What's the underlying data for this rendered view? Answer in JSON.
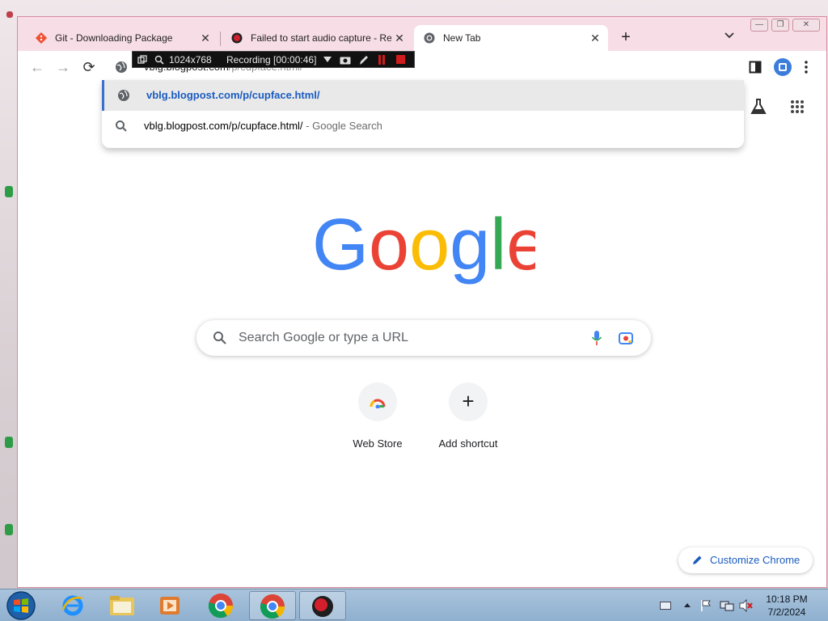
{
  "tabs": [
    {
      "title": "Git - Downloading Package",
      "icon": "git-icon"
    },
    {
      "title": "Failed to start audio capture - Re",
      "icon": "record-icon"
    },
    {
      "title": "New Tab",
      "icon": "chrome-icon",
      "active": true
    }
  ],
  "tab_close_glyph": "✕",
  "new_tab_glyph": "+",
  "tab_search_glyph": "⌄",
  "window_controls": {
    "minimize": "—",
    "restore": "❐",
    "close": "✕"
  },
  "nav": {
    "back": "←",
    "forward": "→",
    "reload": "⟳"
  },
  "omnibox": {
    "typed": "vblg.blogpost.com",
    "completion": "/p/cupface.html/"
  },
  "suggestions": [
    {
      "text": "vblg.blogpost.com/p/cupface.html/",
      "suffix": "",
      "icon": "globe-icon",
      "selected": true
    },
    {
      "text": "vblg.blogpost.com/p/cupface.html/",
      "suffix": " - Google Search",
      "icon": "search-icon"
    }
  ],
  "recorder": {
    "resolution": "1024x768",
    "status": "Recording [00:00:46]"
  },
  "search": {
    "placeholder": "Search Google or type a URL"
  },
  "shortcuts": [
    {
      "label": "Web Store",
      "icon": "webstore-icon"
    },
    {
      "label": "Add shortcut",
      "icon": "plus-icon",
      "glyph": "+"
    }
  ],
  "customize_label": "Customize Chrome",
  "clock": {
    "time": "10:18 PM",
    "date": "7/2/2024"
  },
  "colors": {
    "tabstrip": "#f7dde5",
    "accent": "#1a5bbf",
    "google_blue": "#4285f4",
    "google_red": "#ea4335",
    "google_yellow": "#fbbc05",
    "google_green": "#34a853"
  }
}
